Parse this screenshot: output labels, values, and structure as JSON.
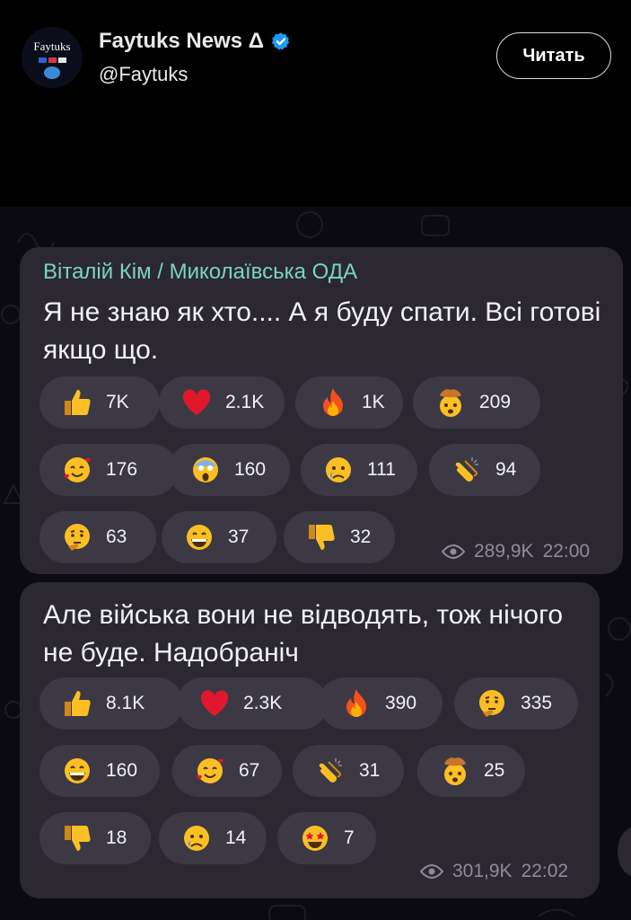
{
  "tweet": {
    "author_name": "Faytuks News Δ",
    "author_handle": "@Faytuks",
    "avatar_text": "Faytuks",
    "follow_label": "Читать"
  },
  "messages": [
    {
      "sender": "Віталій Кім / Миколаївська ОДА",
      "text": "Я не знаю як хто.... А я буду спати. Всі готові якщо що.",
      "views": "289,9K",
      "time": "22:00",
      "reactions": [
        {
          "emoji": "thumbs-up",
          "count": "7K"
        },
        {
          "emoji": "red-heart",
          "count": "2.1K"
        },
        {
          "emoji": "fire",
          "count": "1K"
        },
        {
          "emoji": "exploding-head",
          "count": "209"
        },
        {
          "emoji": "smiling-face-with-hearts",
          "count": "176"
        },
        {
          "emoji": "face-screaming-in-fear",
          "count": "160"
        },
        {
          "emoji": "crying-face",
          "count": "111"
        },
        {
          "emoji": "clapping-hands",
          "count": "94"
        },
        {
          "emoji": "thinking-face",
          "count": "63"
        },
        {
          "emoji": "grinning-face",
          "count": "37"
        },
        {
          "emoji": "thumbs-down",
          "count": "32"
        }
      ]
    },
    {
      "sender": "",
      "text": "Але війська вони не відводять, тож нічого не буде. Надобраніч",
      "views": "301,9K",
      "time": "22:02",
      "reactions": [
        {
          "emoji": "thumbs-up",
          "count": "8.1K"
        },
        {
          "emoji": "red-heart",
          "count": "2.3K"
        },
        {
          "emoji": "fire",
          "count": "390"
        },
        {
          "emoji": "thinking-face",
          "count": "335"
        },
        {
          "emoji": "grinning-face",
          "count": "160"
        },
        {
          "emoji": "smiling-face-with-hearts",
          "count": "67"
        },
        {
          "emoji": "clapping-hands",
          "count": "31"
        },
        {
          "emoji": "exploding-head",
          "count": "25"
        },
        {
          "emoji": "thumbs-down",
          "count": "18"
        },
        {
          "emoji": "crying-face",
          "count": "14"
        },
        {
          "emoji": "star-struck",
          "count": "7"
        }
      ]
    }
  ],
  "colors": {
    "background": "#000000",
    "chat_background": "#0b0a10",
    "bubble": "#2b2832",
    "reaction_pill": "#3c3945",
    "sender_name": "#7ad3c2",
    "meta_text": "#8f8b98",
    "verified_badge": "#1d9bf0"
  }
}
